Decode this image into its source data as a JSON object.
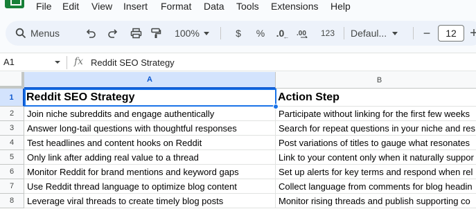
{
  "menu": {
    "items": [
      "File",
      "Edit",
      "View",
      "Insert",
      "Format",
      "Data",
      "Tools",
      "Extensions",
      "Help"
    ]
  },
  "toolbar": {
    "menus_label": "Menus",
    "zoom": "100%",
    "currency": "$",
    "percent": "%",
    "decrease_decimals": ".0",
    "number_format": "123",
    "font": "Defaul...",
    "decrease_font": "−",
    "font_size": "12",
    "increase_font": "+"
  },
  "formula_bar": {
    "cell_ref": "A1",
    "fx": "fx",
    "content": "Reddit SEO Strategy"
  },
  "grid": {
    "columns": [
      "A",
      "B"
    ],
    "rows": [
      {
        "num": "1",
        "a": "Reddit SEO Strategy",
        "b": "Action Step"
      },
      {
        "num": "2",
        "a": "Join niche subreddits and engage authentically",
        "b": "Participate without linking for the first few weeks"
      },
      {
        "num": "3",
        "a": "Answer long-tail questions with thoughtful responses",
        "b": "Search for repeat questions in your niche and res"
      },
      {
        "num": "4",
        "a": "Test headlines and content hooks on Reddit",
        "b": "Post variations of titles to gauge what resonates"
      },
      {
        "num": "5",
        "a": "Only link after adding real value to a thread",
        "b": "Link to your content only when it naturally suppor"
      },
      {
        "num": "6",
        "a": "Monitor Reddit for brand mentions and keyword gaps",
        "b": "Set up alerts for key terms and respond when rel"
      },
      {
        "num": "7",
        "a": "Use Reddit thread language to optimize blog content",
        "b": "Collect language from comments for blog headin"
      },
      {
        "num": "8",
        "a": "Leverage viral threads to create timely blog posts",
        "b": "Monitor rising threads and publish supporting co"
      }
    ]
  },
  "colors": {
    "accent": "#0b57d0",
    "selection": "#1a73e8",
    "logo": "#188038"
  }
}
